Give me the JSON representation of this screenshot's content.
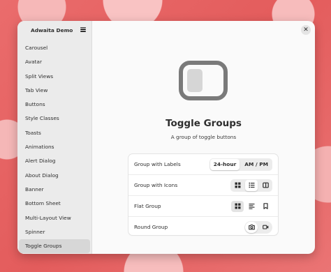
{
  "window": {
    "sidebar_title": "Adwaita Demo"
  },
  "sidebar": {
    "items": [
      {
        "label": "Carousel"
      },
      {
        "label": "Avatar"
      },
      {
        "label": "Split Views"
      },
      {
        "label": "Tab View"
      },
      {
        "label": "Buttons"
      },
      {
        "label": "Style Classes"
      },
      {
        "label": "Toasts"
      },
      {
        "label": "Animations"
      },
      {
        "label": "Alert Dialog"
      },
      {
        "label": "About Dialog"
      },
      {
        "label": "Banner"
      },
      {
        "label": "Bottom Sheet"
      },
      {
        "label": "Multi-Layout View"
      },
      {
        "label": "Spinner"
      },
      {
        "label": "Toggle Groups"
      }
    ],
    "selected": "Toggle Groups"
  },
  "main": {
    "title": "Toggle Groups",
    "subtitle": "A group of toggle buttons",
    "rows": [
      {
        "label": "Group with Labels",
        "options": [
          "24-hour",
          "AM / PM"
        ],
        "selected": "24-hour"
      },
      {
        "label": "Group with Icons",
        "icons": [
          "grid-view-icon",
          "list-view-icon",
          "columns-view-icon"
        ],
        "selected": "list-view-icon"
      },
      {
        "label": "Flat Group",
        "icons": [
          "grid-view-icon",
          "text-justify-icon",
          "bookmark-icon"
        ],
        "selected": "grid-view-icon"
      },
      {
        "label": "Round Group",
        "icons": [
          "camera-icon",
          "video-camera-icon"
        ],
        "selected": "camera-icon"
      }
    ]
  },
  "icons": {
    "menu": "hamburger-menu-icon",
    "close": "close-icon",
    "hero": "toggle-switch-icon"
  }
}
